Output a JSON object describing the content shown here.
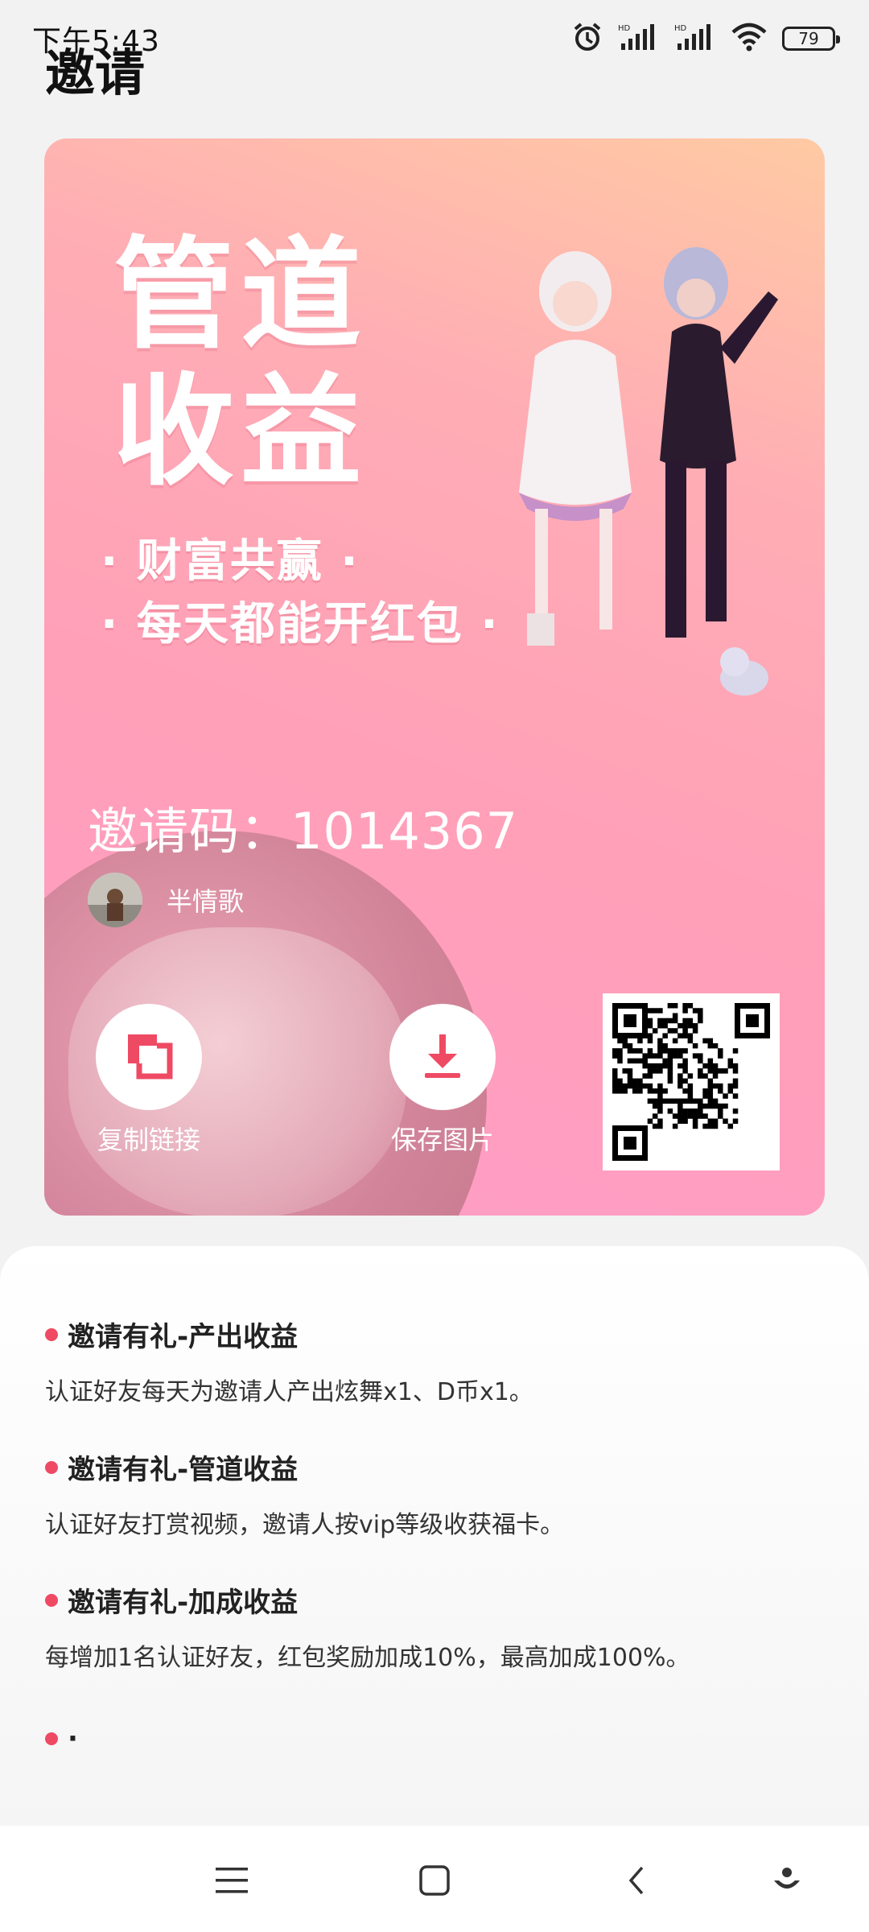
{
  "status_bar": {
    "time": "下午5:43",
    "battery": "79"
  },
  "page": {
    "title": "邀请"
  },
  "poster": {
    "headline_line1": "管道",
    "headline_line2": "收益",
    "slogan_line1": "· 财富共赢 ·",
    "slogan_line2": "· 每天都能开红包 ·",
    "invite_code_label": "邀请码：1014367",
    "user_name": "半情歌",
    "copy_link_label": "复制链接",
    "save_image_label": "保存图片"
  },
  "info": {
    "items": [
      {
        "title": "邀请有礼-产出收益",
        "desc": "认证好友每天为邀请人产出炫舞x1、D币x1。"
      },
      {
        "title": "邀请有礼-管道收益",
        "desc": "认证好友打赏视频，邀请人按vip等级收获福卡。"
      },
      {
        "title": "邀请有礼-加成收益",
        "desc": "每增加1名认证好友，红包奖励加成10%，最高加成100%。"
      },
      {
        "title": "·",
        "desc": ""
      }
    ]
  },
  "colors": {
    "accent": "#ef4a63",
    "poster_pink": "#ff9fb8",
    "poster_peach": "#ffcaa3"
  },
  "icons": [
    "alarm-icon",
    "hd-signal-icon",
    "wifi-icon",
    "battery-icon",
    "copy-icon",
    "download-icon",
    "menu-icon",
    "home-icon",
    "back-icon",
    "assistant-icon"
  ]
}
